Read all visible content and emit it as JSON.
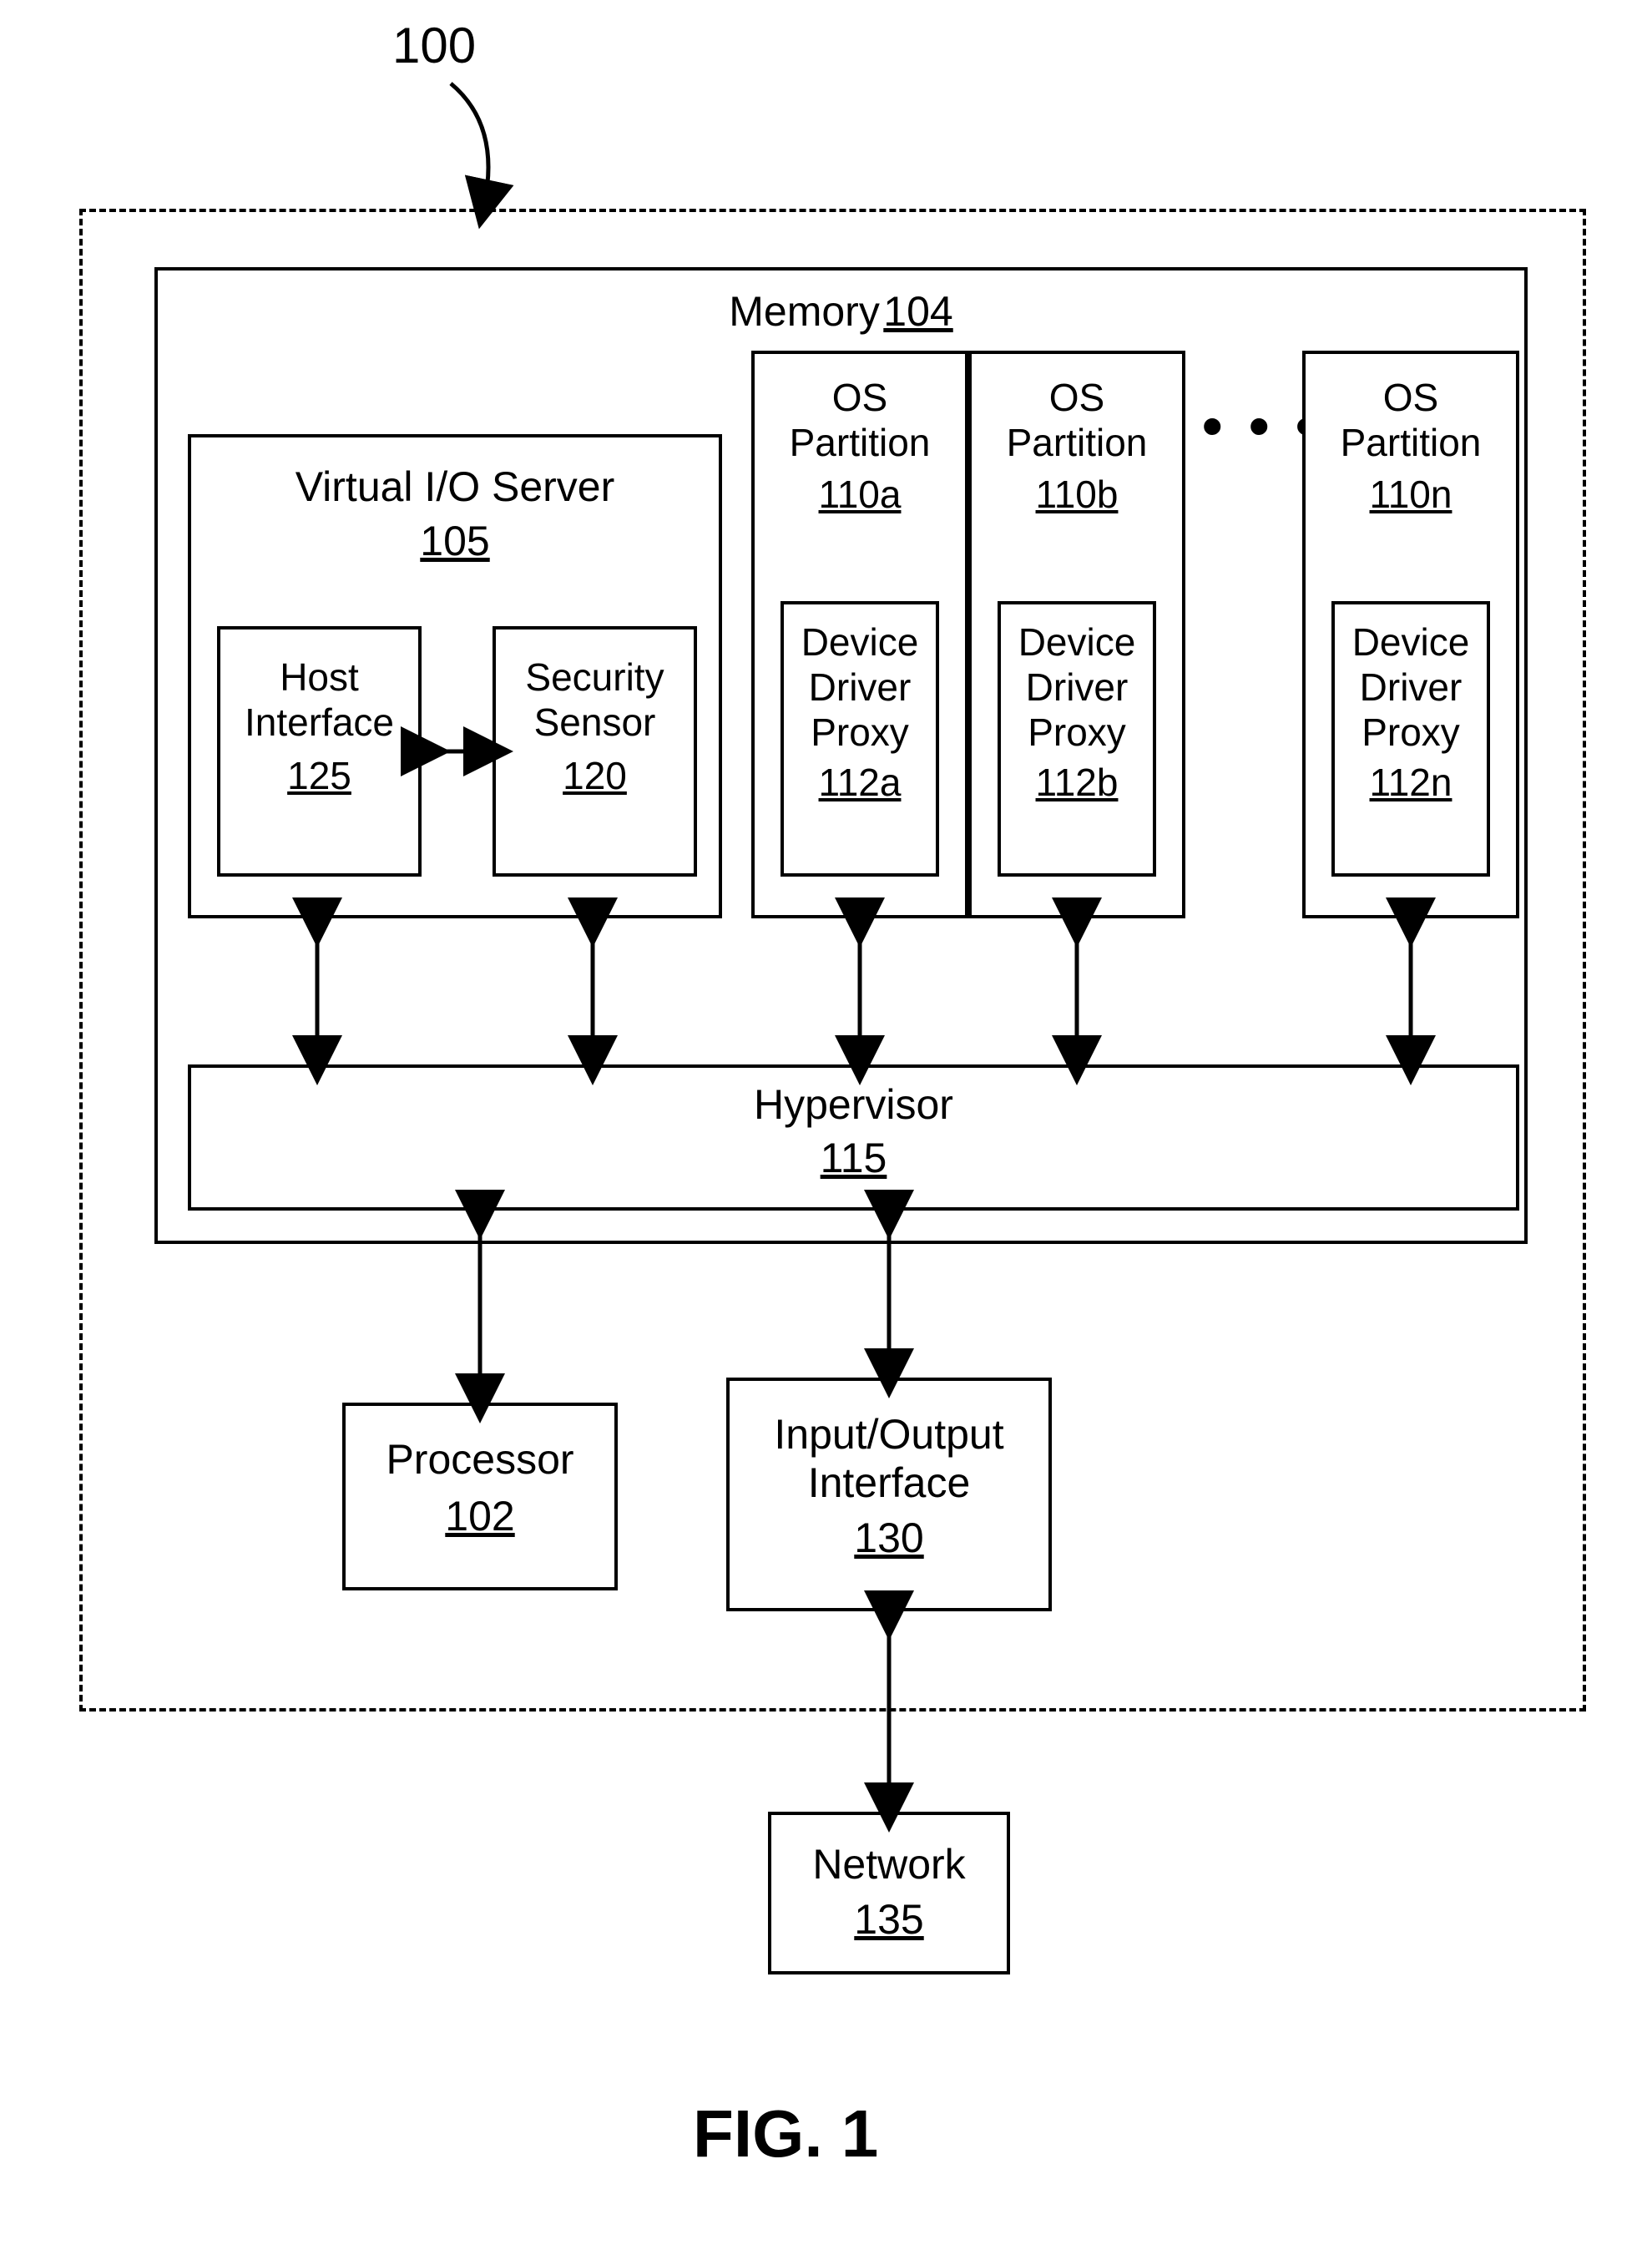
{
  "system": {
    "ref": "100"
  },
  "memory": {
    "title": "Memory",
    "ref": "104"
  },
  "vio": {
    "title": "Virtual I/O Server",
    "ref": "105"
  },
  "host_if": {
    "title_l1": "Host",
    "title_l2": "Interface",
    "ref": "125"
  },
  "sec_sensor": {
    "title_l1": "Security",
    "title_l2": "Sensor",
    "ref": "120"
  },
  "partitions": [
    {
      "title_l1": "OS",
      "title_l2": "Partition",
      "ref": "110a",
      "proxy_l1": "Device",
      "proxy_l2": "Driver",
      "proxy_l3": "Proxy",
      "proxy_ref": "112a"
    },
    {
      "title_l1": "OS",
      "title_l2": "Partition",
      "ref": "110b",
      "proxy_l1": "Device",
      "proxy_l2": "Driver",
      "proxy_l3": "Proxy",
      "proxy_ref": "112b"
    },
    {
      "title_l1": "OS",
      "title_l2": "Partition",
      "ref": "110n",
      "proxy_l1": "Device",
      "proxy_l2": "Driver",
      "proxy_l3": "Proxy",
      "proxy_ref": "112n"
    }
  ],
  "ellipsis": "• • •",
  "hypervisor": {
    "title": "Hypervisor",
    "ref": "115"
  },
  "processor": {
    "title": "Processor",
    "ref": "102"
  },
  "io_if": {
    "title_l1": "Input/Output",
    "title_l2": "Interface",
    "ref": "130"
  },
  "network": {
    "title": "Network",
    "ref": "135"
  },
  "figure": "FIG. 1"
}
